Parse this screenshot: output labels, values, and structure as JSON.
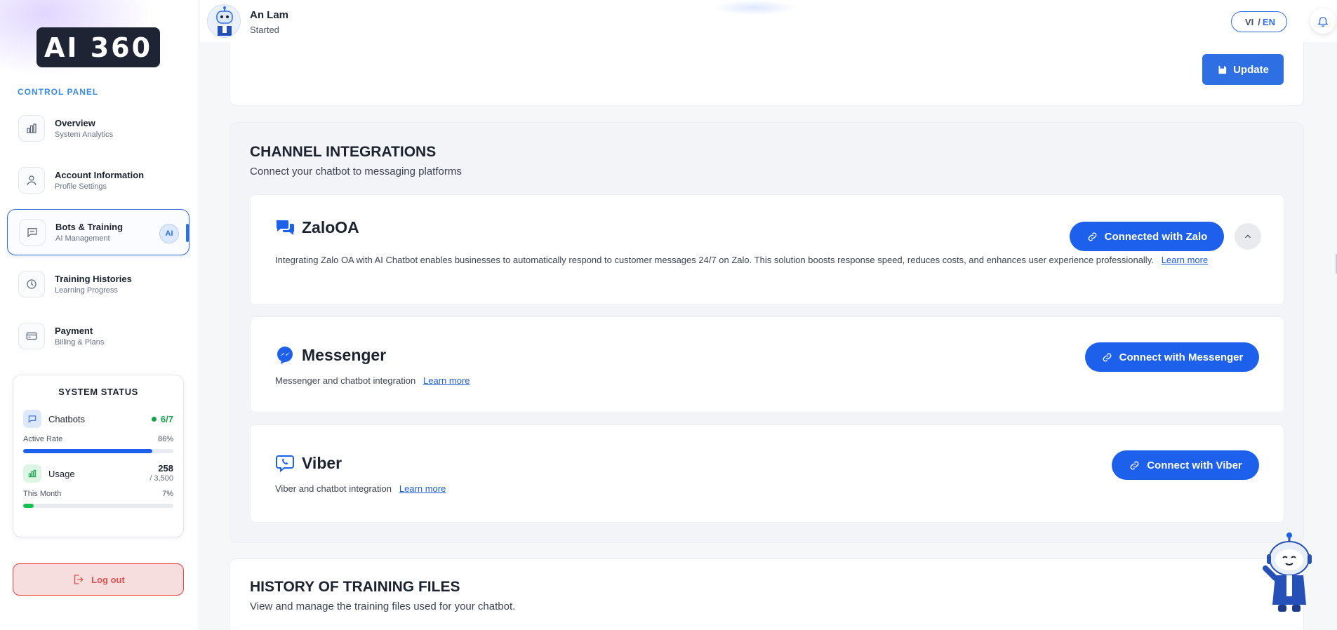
{
  "brand": {
    "logo_text": "AI 360"
  },
  "sidebar": {
    "section_label": "CONTROL PANEL",
    "items": [
      {
        "title": "Overview",
        "subtitle": "System Analytics",
        "icon": "bar-chart-icon"
      },
      {
        "title": "Account Information",
        "subtitle": "Profile Settings",
        "icon": "user-icon"
      },
      {
        "title": "Bots & Training",
        "subtitle": "AI Management",
        "icon": "chat-icon",
        "badge": "AI",
        "active": true
      },
      {
        "title": "Training Histories",
        "subtitle": "Learning Progress",
        "icon": "clock-icon"
      },
      {
        "title": "Payment",
        "subtitle": "Billing & Plans",
        "icon": "card-icon"
      }
    ],
    "system_status": {
      "title": "SYSTEM STATUS",
      "chatbots": {
        "label": "Chatbots",
        "value": "6/7",
        "rate_label": "Active Rate",
        "rate_value": "86%",
        "rate_fraction": 0.86,
        "color": "#1c60ec"
      },
      "usage": {
        "label": "Usage",
        "value": "258",
        "limit": "/ 3,500",
        "period_label": "This Month",
        "period_value": "7%",
        "fraction": 0.07,
        "color": "#16c24f"
      }
    },
    "logout_label": "Log out"
  },
  "header": {
    "user_name": "An Lam",
    "user_status": "Started",
    "lang_vi": "VI",
    "lang_sep": "/",
    "lang_en": "EN"
  },
  "top_card": {
    "update_label": "Update"
  },
  "channels": {
    "title": "CHANNEL INTEGRATIONS",
    "subtitle": "Connect your chatbot to messaging platforms",
    "items": [
      {
        "name": "ZaloOA",
        "description": "Integrating Zalo OA with AI Chatbot enables businesses to automatically respond to customer messages 24/7 on Zalo. This solution boosts response speed, reduces costs, and enhances user experience professionally.",
        "learn_more": "Learn more",
        "button": "Connected with Zalo"
      },
      {
        "name": "Messenger",
        "description": "Messenger and chatbot integration",
        "learn_more": "Learn more",
        "button": "Connect with Messenger"
      },
      {
        "name": "Viber",
        "description": "Viber and chatbot integration",
        "learn_more": "Learn more",
        "button": "Connect with Viber"
      }
    ]
  },
  "history": {
    "title": "HISTORY OF TRAINING FILES",
    "subtitle": "View and manage the training files used for your chatbot."
  },
  "colors": {
    "primary": "#1c60ec",
    "danger": "#ef4444",
    "success": "#16a34a"
  }
}
